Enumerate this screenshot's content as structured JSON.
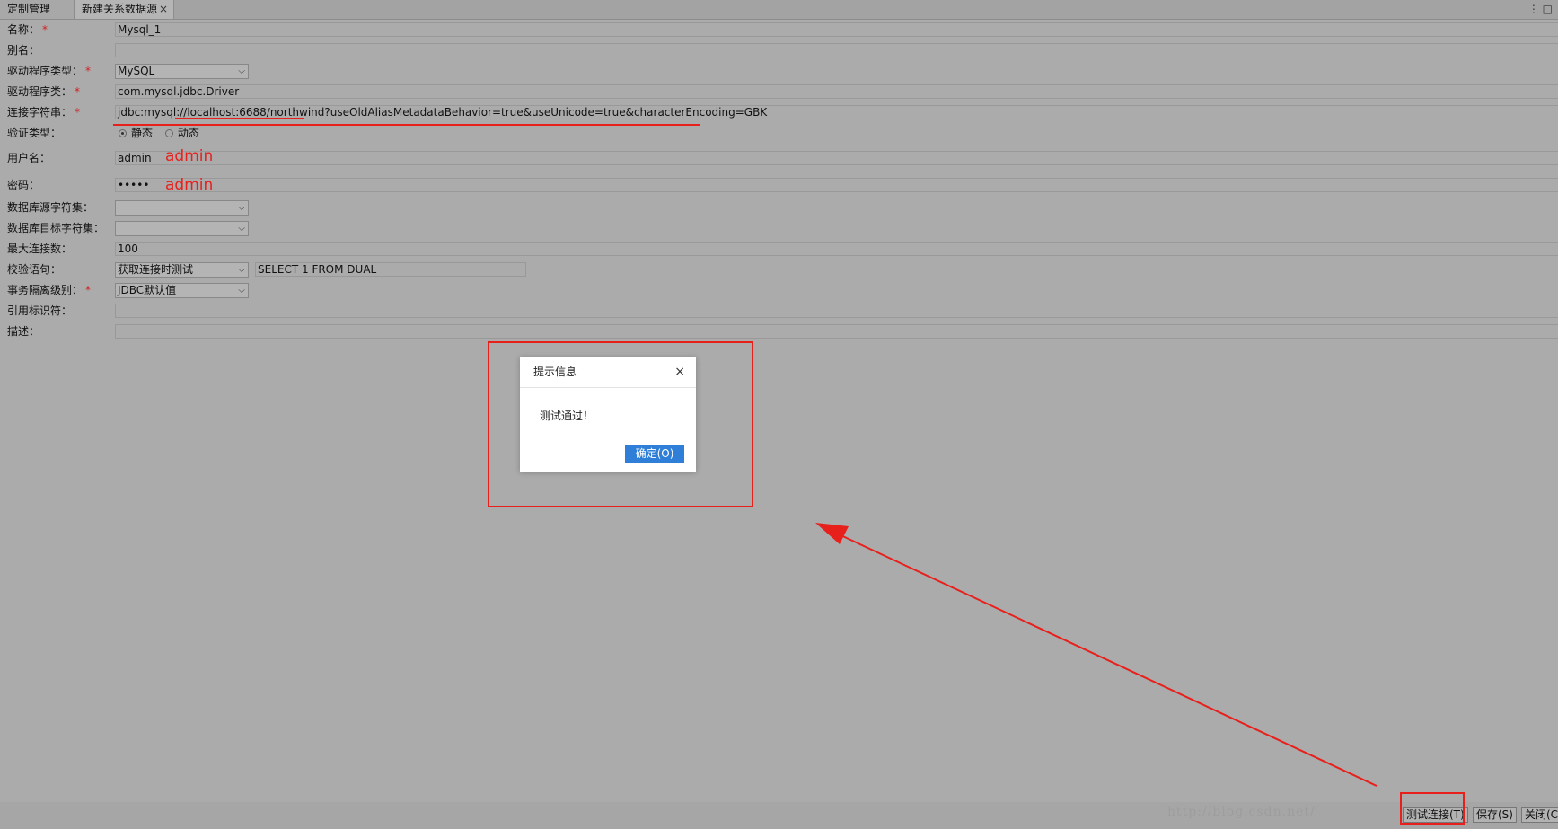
{
  "tabs": [
    {
      "label": "定制管理"
    },
    {
      "label": "新建关系数据源",
      "close": "×"
    }
  ],
  "tab_menu": "⋮ □",
  "form": {
    "name": {
      "label": "名称：",
      "req": "*",
      "value": "Mysql_1"
    },
    "alias": {
      "label": "别名：",
      "value": ""
    },
    "driver_type": {
      "label": "驱动程序类型：",
      "req": "*",
      "value": "MySQL"
    },
    "driver_class": {
      "label": "驱动程序类：",
      "req": "*",
      "value": "com.mysql.jdbc.Driver"
    },
    "conn_str": {
      "label": "连接字符串：",
      "req": "*",
      "value": "jdbc:mysql://localhost:6688/northwind?useOldAliasMetadataBehavior=true&useUnicode=true&characterEncoding=GBK"
    },
    "auth_type": {
      "label": "验证类型：",
      "options": [
        "静态",
        "动态"
      ],
      "selected": "静态"
    },
    "username": {
      "label": "用户名：",
      "value": "admin",
      "annotation": "admin"
    },
    "password": {
      "label": "密码：",
      "value": "•••••",
      "annotation": "admin"
    },
    "src_charset": {
      "label": "数据库源字符集：",
      "value": ""
    },
    "dst_charset": {
      "label": "数据库目标字符集：",
      "value": ""
    },
    "max_conn": {
      "label": "最大连接数：",
      "value": "100"
    },
    "check_sql": {
      "label": "校验语句：",
      "mode": "获取连接时测试",
      "value": "SELECT 1 FROM DUAL"
    },
    "isolation": {
      "label": "事务隔离级别：",
      "req": "*",
      "value": "JDBC默认值"
    },
    "quote_char": {
      "label": "引用标识符：",
      "value": ""
    },
    "description": {
      "label": "描述：",
      "value": ""
    }
  },
  "dialog": {
    "title": "提示信息",
    "close": "×",
    "message": "测试通过！",
    "ok_label": "确定(O)"
  },
  "bottom_buttons": {
    "test": "测试连接(T)",
    "save": "保存(S)",
    "close": "关闭(C"
  },
  "watermark": "http://blog.csdn.net/",
  "colors": {
    "annotation_red": "#e8201c",
    "dialog_button": "#2f7fd8",
    "background": "#ababab"
  }
}
